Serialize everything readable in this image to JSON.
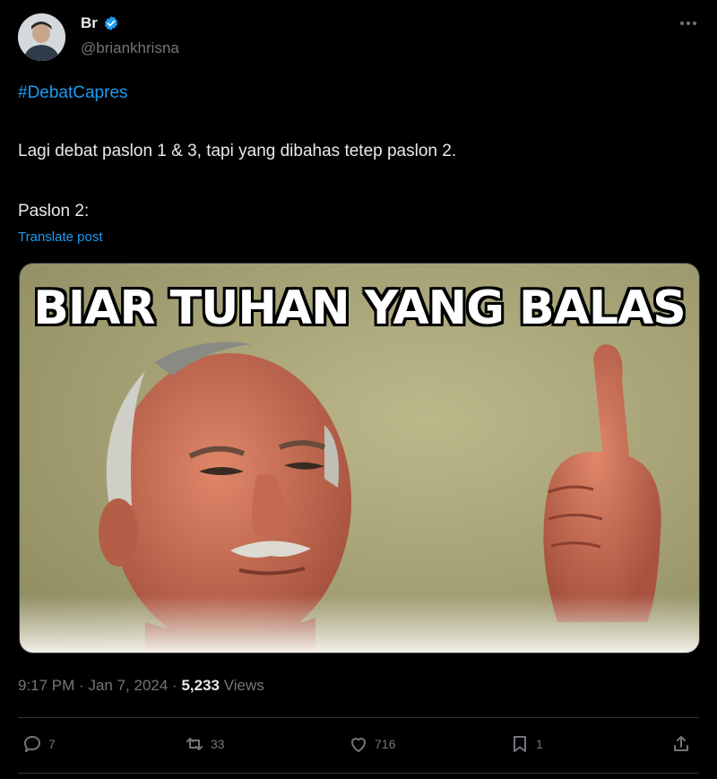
{
  "author": {
    "display_name": "Br",
    "handle": "@briankhrisna",
    "verified": true
  },
  "tweet": {
    "hashtag": "#DebatCapres",
    "line1": "Lagi debat paslon 1 & 3, tapi yang dibahas tetep paslon 2.",
    "line2": "Paslon 2:",
    "translate_label": "Translate post"
  },
  "media": {
    "caption": "BIAR TUHAN YANG BALAS"
  },
  "meta": {
    "time": "9:17 PM",
    "date": "Jan 7, 2024",
    "separator": "·",
    "views_count": "5,233",
    "views_label": "Views"
  },
  "actions": {
    "replies": "7",
    "reposts": "33",
    "likes": "716",
    "bookmarks": "1"
  },
  "colors": {
    "background": "#000000",
    "accent": "#1d9bf0",
    "muted": "#71767b",
    "text": "#e7e9ea"
  }
}
